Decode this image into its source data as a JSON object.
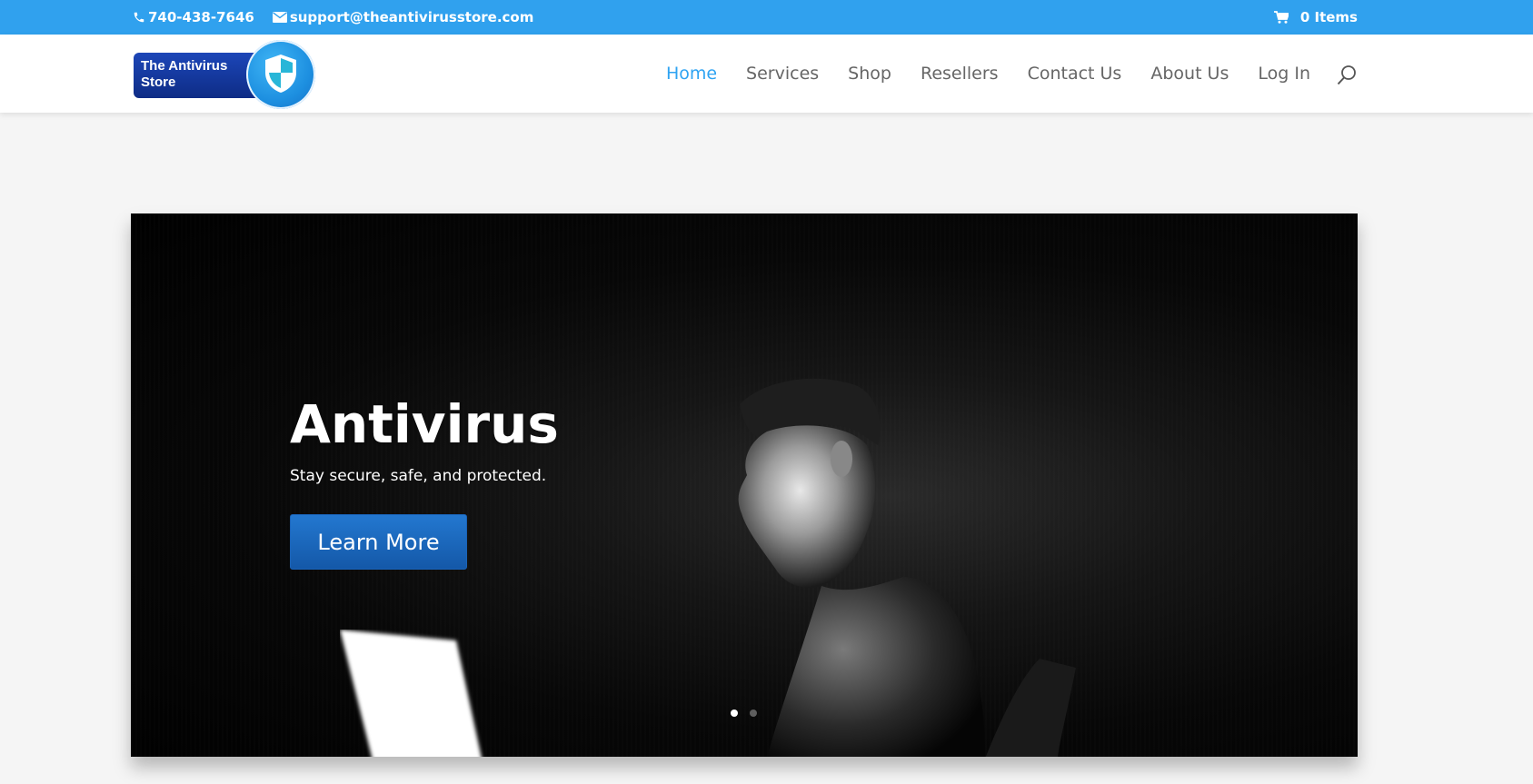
{
  "topbar": {
    "phone": "740-438-7646",
    "email": "support@theantivirusstore.com",
    "cart_label": "0 Items",
    "background": "#30a1ee"
  },
  "header": {
    "logo_text_line1": "The Antivirus",
    "logo_text_line2": "Store",
    "nav": [
      {
        "label": "Home",
        "active": true
      },
      {
        "label": "Services",
        "active": false
      },
      {
        "label": "Shop",
        "active": false
      },
      {
        "label": "Resellers",
        "active": false
      },
      {
        "label": "Contact Us",
        "active": false
      },
      {
        "label": "About Us",
        "active": false
      },
      {
        "label": "Log In",
        "active": false
      }
    ],
    "accent_color": "#2ea3f2"
  },
  "hero": {
    "title": "Antivirus",
    "subtitle": "Stay secure, safe, and protected.",
    "button_label": "Learn More",
    "slides": 2,
    "active_slide": 1
  },
  "icons": {
    "phone": "phone-icon",
    "email": "envelope-icon",
    "cart": "cart-icon",
    "search": "search-icon",
    "logo": "shield-icon"
  }
}
